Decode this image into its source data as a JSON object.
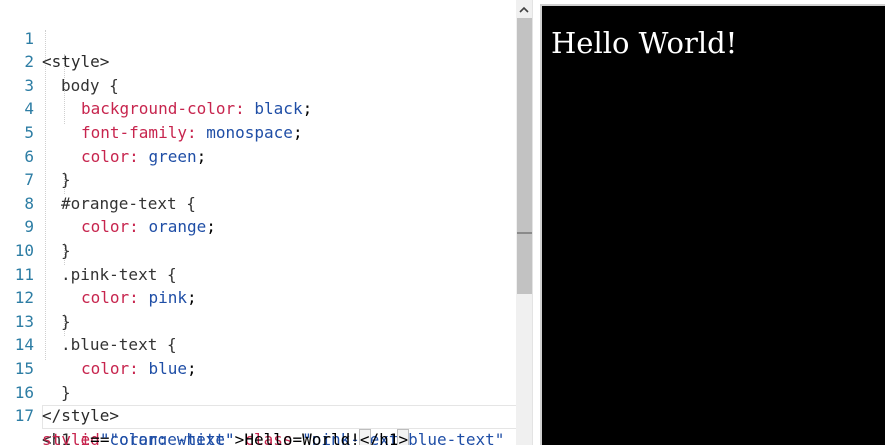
{
  "editor": {
    "line_numbers": [
      "1",
      "2",
      "3",
      "4",
      "5",
      "6",
      "7",
      "8",
      "9",
      "10",
      "11",
      "12",
      "13",
      "14",
      "15",
      "16",
      "17"
    ],
    "lines": {
      "l1": {
        "tag": "<style>"
      },
      "l2": {
        "sel": "body {"
      },
      "l3": {
        "prop": "background-color:",
        "val": "black",
        "end": ";"
      },
      "l4": {
        "prop": "font-family:",
        "val": "monospace",
        "end": ";"
      },
      "l5": {
        "prop": "color:",
        "val": "green",
        "end": ";"
      },
      "l6": {
        "sel": "}"
      },
      "l7": {
        "sel": "#orange-text {"
      },
      "l8": {
        "prop": "color:",
        "val": "orange",
        "end": ";"
      },
      "l9": {
        "sel": "}"
      },
      "l10": {
        "sel": ".pink-text {"
      },
      "l11": {
        "prop": "color:",
        "val": "pink",
        "end": ";"
      },
      "l12": {
        "sel": "}"
      },
      "l13": {
        "sel": ".blue-text {"
      },
      "l14": {
        "prop": "color:",
        "val": "blue",
        "end": ";"
      },
      "l15": {
        "sel": "}"
      },
      "l16": {
        "tag": "</style>"
      },
      "l17": {
        "open": "<h1",
        "attr_id": "id",
        "eq": "=",
        "id_val": "\"orange-text\"",
        "attr_class": "class",
        "class_val": "\"pink-text blue-text\""
      },
      "l17b": {
        "attr_style": "style",
        "eq": "=",
        "style_val": "\"color: white\"",
        "gt": ">",
        "text": "Hello World!",
        "close_lt": "<",
        "close_rest": "/h1",
        "close_gt": ">"
      }
    }
  },
  "preview": {
    "heading": "Hello World!",
    "background_color": "#000000",
    "text_color": "#ffffff"
  },
  "colors": {
    "gutter": "#2d7da4",
    "property": "#c7254e",
    "value": "#1f4ea6",
    "scrollbar_thumb": "#c2c2c2"
  }
}
